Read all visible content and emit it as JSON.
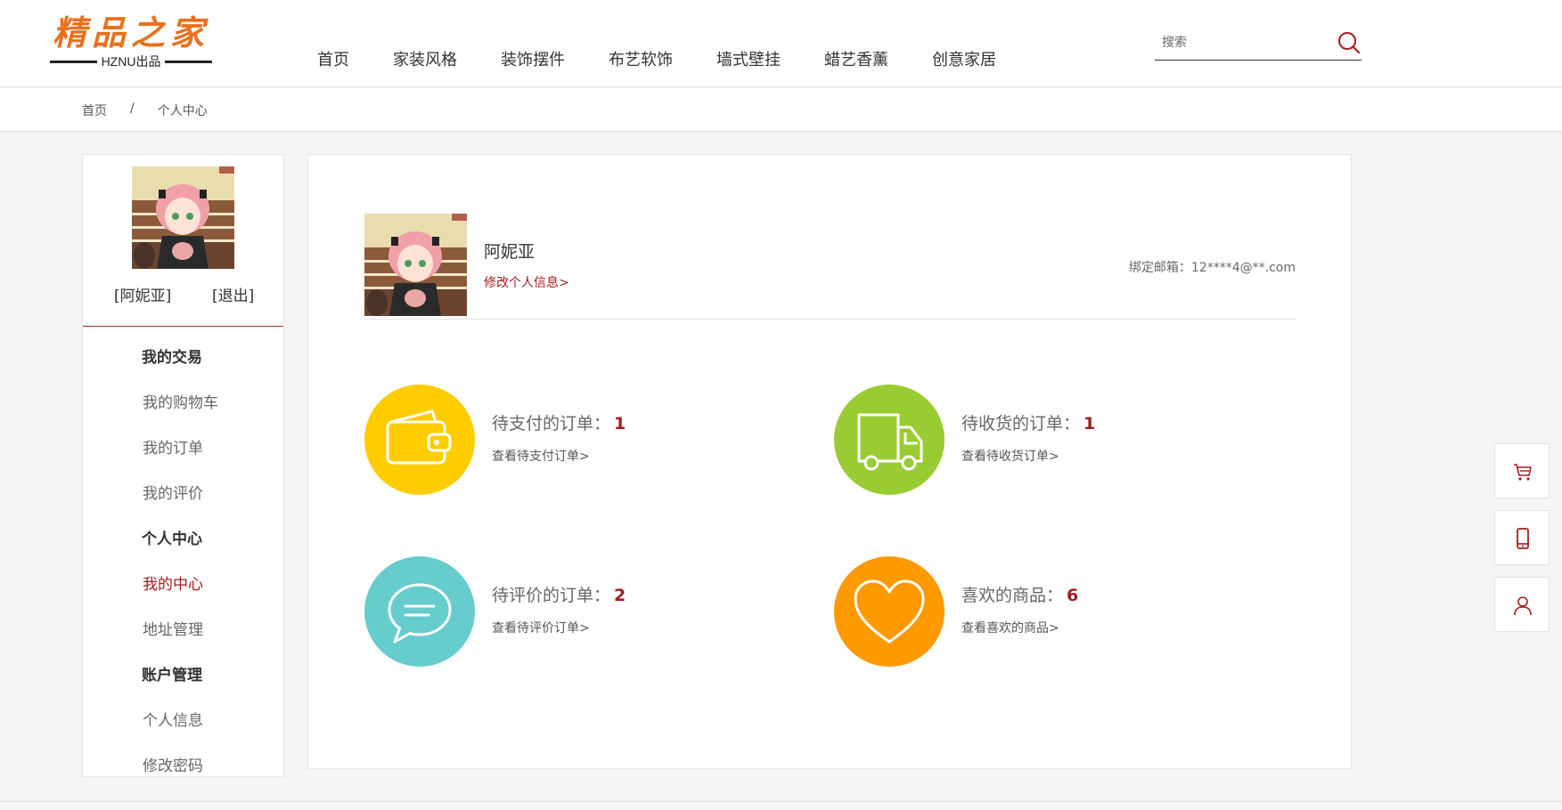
{
  "header": {
    "logo_title": "精品之家",
    "logo_sub": "HZNU出品",
    "nav": [
      "首页",
      "家装风格",
      "装饰摆件",
      "布艺软饰",
      "墙式壁挂",
      "蜡艺香薰",
      "创意家居"
    ],
    "search_placeholder": "搜索"
  },
  "breadcrumb": {
    "home": "首页",
    "separator": "/",
    "current": "个人中心"
  },
  "sidebar": {
    "user": "[阿妮亚]",
    "logout": "[退出]",
    "groups": [
      {
        "title": "我的交易",
        "items": [
          "我的购物车",
          "我的订单",
          "我的评价"
        ]
      },
      {
        "title": "个人中心",
        "items": [
          "我的中心",
          "地址管理"
        ]
      },
      {
        "title": "账户管理",
        "items": [
          "个人信息",
          "修改密码"
        ]
      }
    ],
    "active_item": "我的中心"
  },
  "profile": {
    "name": "阿妮亚",
    "edit_link": "修改个人信息>",
    "email_label": "绑定邮箱：",
    "email": "12****4@**.com"
  },
  "stats": [
    {
      "title": "待支付的订单：",
      "count": "1",
      "link": "查看待支付订单>",
      "icon": "wallet-icon",
      "color": "#ffcc00"
    },
    {
      "title": "待收货的订单：",
      "count": "1",
      "link": "查看待收货订单>",
      "icon": "truck-icon",
      "color": "#99cc33"
    },
    {
      "title": "待评价的订单：",
      "count": "2",
      "link": "查看待评价订单>",
      "icon": "chat-icon",
      "color": "#66cccc"
    },
    {
      "title": "喜欢的商品：",
      "count": "6",
      "link": "查看喜欢的商品>",
      "icon": "heart-icon",
      "color": "#ff9900"
    }
  ],
  "floating": [
    "cart-icon",
    "mobile-icon",
    "user-icon"
  ],
  "colors": {
    "accent": "#a31d1d",
    "logo": "#e8711e"
  }
}
